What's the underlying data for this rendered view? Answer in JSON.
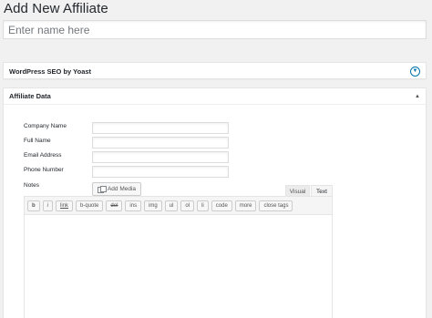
{
  "page": {
    "title": "Add New Affiliate",
    "name_placeholder": "Enter name here"
  },
  "seo_box": {
    "title": "WordPress SEO by Yoast",
    "toggle_icon": "chevron-down-icon"
  },
  "affiliate_box": {
    "title": "Affiliate Data",
    "toggle_icon": "arrow-up-icon",
    "fields": [
      {
        "label": "Company Name",
        "value": ""
      },
      {
        "label": "Full Name",
        "value": ""
      },
      {
        "label": "Email Address",
        "value": ""
      },
      {
        "label": "Phone Number",
        "value": ""
      }
    ],
    "notes_label": "Notes"
  },
  "editor": {
    "add_media_label": "Add Media",
    "tabs": [
      "Visual",
      "Text"
    ],
    "active_tab": "Text",
    "quicktags": [
      "b",
      "i",
      "link",
      "b-quote",
      "del",
      "ins",
      "img",
      "ul",
      "ol",
      "li",
      "code",
      "more",
      "close tags"
    ]
  },
  "colors": {
    "background": "#f1f1f1",
    "accent": "#0073aa"
  }
}
